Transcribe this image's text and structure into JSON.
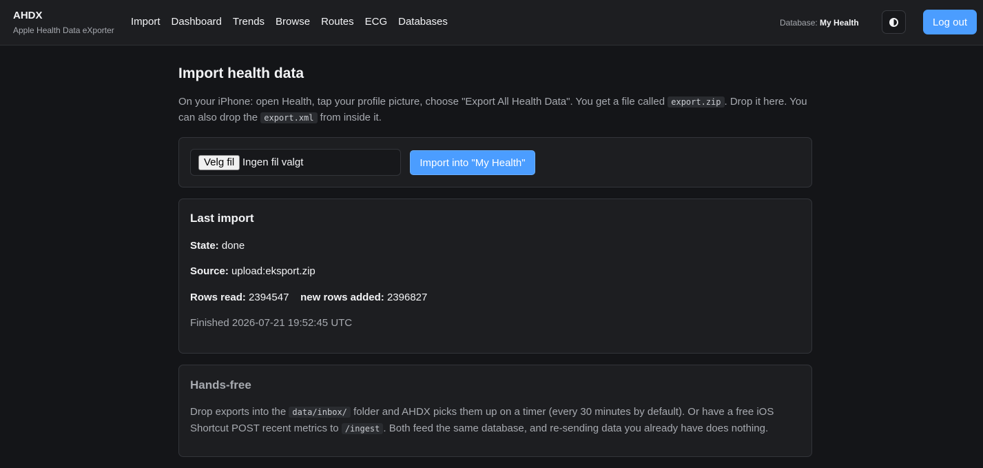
{
  "header": {
    "brand": "AHDX",
    "subtitle": "Apple Health Data eXporter",
    "nav": [
      "Import",
      "Dashboard",
      "Trends",
      "Browse",
      "Routes",
      "ECG",
      "Databases"
    ],
    "database_label": "Database:",
    "database_name": "My Health",
    "theme_icon": "contrast-icon",
    "logout_label": "Log out"
  },
  "page": {
    "title": "Import health data",
    "intro_1": "On your iPhone: open Health, tap your profile picture, choose \"Export All Health Data\". You get a file called ",
    "intro_code_1": "export.zip",
    "intro_2": ". Drop it here. You can also drop the ",
    "intro_code_2": "export.xml",
    "intro_3": " from inside it."
  },
  "upload": {
    "file_button_label": "Velg fil",
    "file_status": "Ingen fil valgt",
    "import_button_label": "Import into \"My Health\""
  },
  "last_import": {
    "title": "Last import",
    "state_label": "State:",
    "state_value": "done",
    "source_label": "Source:",
    "source_value": "upload:eksport.zip",
    "rows_read_label": "Rows read:",
    "rows_read_value": "2394547",
    "rows_added_label": "new rows added:",
    "rows_added_value": "2396827",
    "finished": "Finished 2026-07-21 19:52:45 UTC"
  },
  "hands_free": {
    "title": "Hands-free",
    "text_1": "Drop exports into the ",
    "code_1": "data/inbox/",
    "text_2": " folder and AHDX picks them up on a timer (every 30 minutes by default). Or have a free iOS Shortcut POST recent metrics to ",
    "code_2": "/ingest",
    "text_3": ". Both feed the same database, and re-sending data you already have does nothing."
  },
  "colors": {
    "accent": "#4b9dff",
    "background": "#141518",
    "card": "#1d1e21"
  }
}
